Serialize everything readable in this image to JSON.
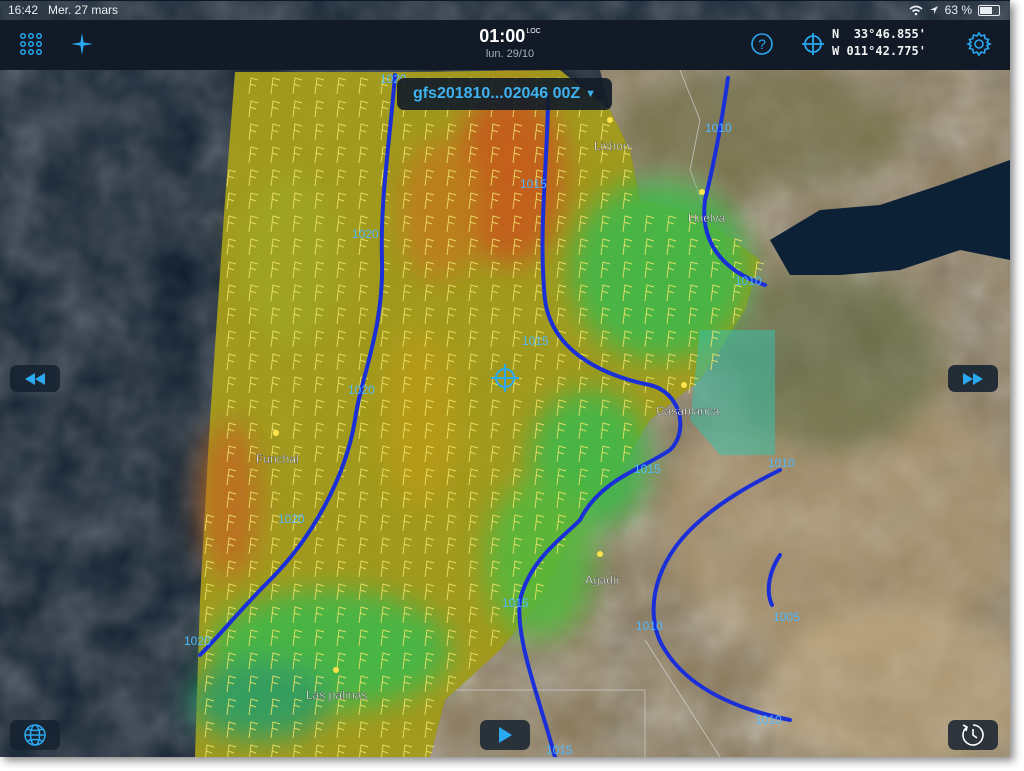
{
  "status_bar": {
    "time": "16:42",
    "date": "Mer. 27 mars",
    "battery": "63 %"
  },
  "toolbar": {
    "clock_time": "01:00",
    "clock_zone": "LOC",
    "clock_date": "lun. 29/10",
    "lat_hemi": "N",
    "lat_value": "33°46.855'",
    "lon_hemi": "W",
    "lon_value": "011°42.775'",
    "icons": [
      "grid-menu-icon",
      "compass-star-icon",
      "help-icon",
      "crosshair-icon",
      "settings-icon"
    ]
  },
  "model_selector": {
    "label": "gfs201810...02046 00Z"
  },
  "map": {
    "places": [
      "Lisbon",
      "Huelva",
      "Casablanca",
      "Funchal",
      "Agadir",
      "Las palmas"
    ],
    "isobar_labels": [
      {
        "text": "1020"
      },
      {
        "text": "1010"
      },
      {
        "text": "1015"
      },
      {
        "text": "1020"
      },
      {
        "text": "1010"
      },
      {
        "text": "1015"
      },
      {
        "text": "1020"
      },
      {
        "text": "1010"
      },
      {
        "text": "1015"
      },
      {
        "text": "1020"
      },
      {
        "text": "1020"
      },
      {
        "text": "1015"
      },
      {
        "text": "1010"
      },
      {
        "text": "1005"
      },
      {
        "text": "1010"
      },
      {
        "text": "1015"
      }
    ],
    "colors": {
      "ocean": "#0b1a2a",
      "land": "#8a7a5c",
      "wind_strong": "#c8561c",
      "wind_medium": "#b9a514",
      "wind_light": "#3fb84a",
      "isobar": "#1a2fd8",
      "accent": "#3fb2f2"
    }
  },
  "controls": {
    "left_button": "rewind-icon",
    "right_button": "fast-forward-icon",
    "play_button": "play-icon",
    "globe_button": "globe-icon",
    "history_button": "clock-history-icon"
  }
}
